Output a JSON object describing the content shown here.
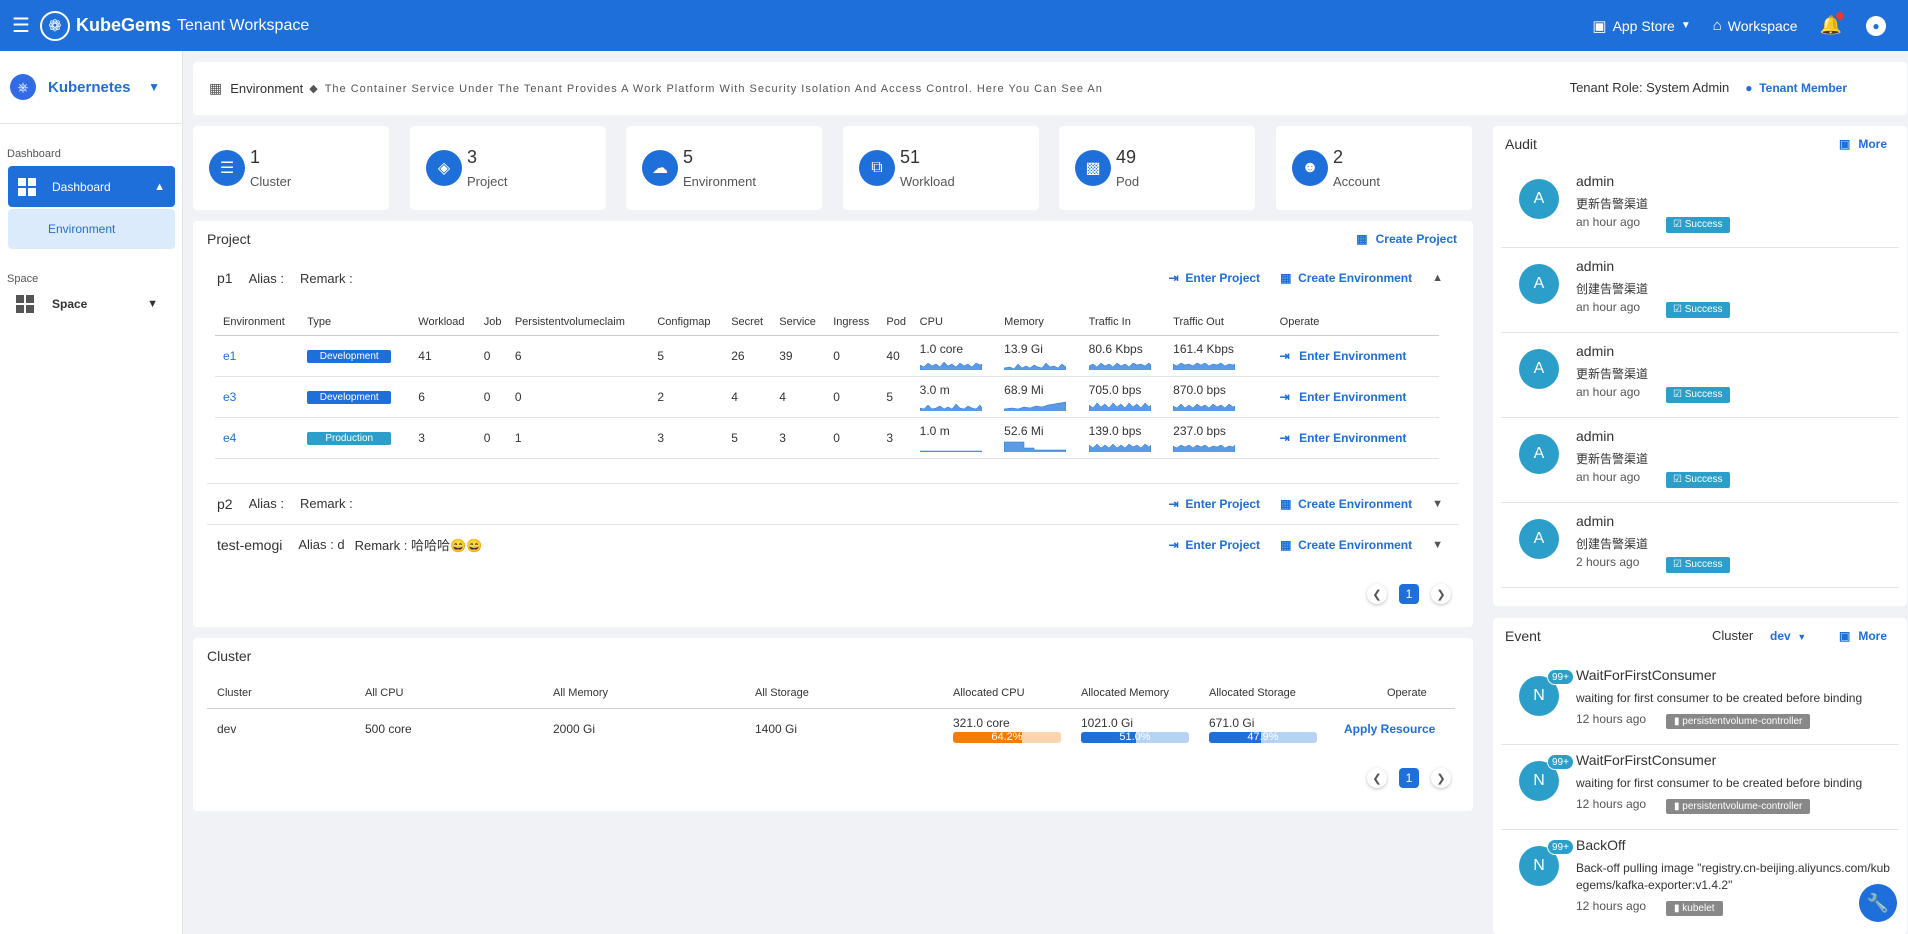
{
  "header": {
    "brand": "KubeGems",
    "subtitle": "Tenant Workspace",
    "app_store": "App Store",
    "workspace": "Workspace"
  },
  "sidebar": {
    "cluster_label": "Kubernetes",
    "section_dashboard": "Dashboard",
    "dashboard_label": "Dashboard",
    "environment_label": "Environment",
    "section_space": "Space",
    "space_label": "Space"
  },
  "envbar": {
    "title": "Environment",
    "description": "The Container Service Under The Tenant Provides A Work Platform With Security Isolation And Access Control. Here You Can See An",
    "role": "Tenant Role: System Admin",
    "member_button": "Tenant Member"
  },
  "stats": [
    {
      "value": "1",
      "label": "Cluster"
    },
    {
      "value": "3",
      "label": "Project"
    },
    {
      "value": "5",
      "label": "Environment"
    },
    {
      "value": "51",
      "label": "Workload"
    },
    {
      "value": "49",
      "label": "Pod"
    },
    {
      "value": "2",
      "label": "Account"
    }
  ],
  "project": {
    "title": "Project",
    "create_project": "Create Project",
    "enter_project": "Enter Project",
    "create_environment": "Create Environment",
    "projects": [
      {
        "name": "p1",
        "alias": "Alias :",
        "remark": "Remark :"
      },
      {
        "name": "p2",
        "alias": "Alias :",
        "remark": "Remark :"
      },
      {
        "name": "test-emogi",
        "alias": "Alias : d",
        "remark": "Remark : 哈哈哈😄😄"
      }
    ],
    "columns": [
      "Environment",
      "Type",
      "Workload",
      "Job",
      "Persistentvolumeclaim",
      "Configmap",
      "Secret",
      "Service",
      "Ingress",
      "Pod",
      "CPU",
      "Memory",
      "Traffic In",
      "Traffic Out",
      "Operate"
    ],
    "enter_environment": "Enter Environment",
    "rows": [
      {
        "env": "e1",
        "type": "Development",
        "workload": "41",
        "job": "0",
        "pvc": "6",
        "configmap": "5",
        "secret": "26",
        "service": "39",
        "ingress": "0",
        "pod": "40",
        "cpu": "1.0 core",
        "memory": "13.9 Gi",
        "traffic_in": "80.6 Kbps",
        "traffic_out": "161.4 Kbps"
      },
      {
        "env": "e3",
        "type": "Development",
        "workload": "6",
        "job": "0",
        "pvc": "0",
        "configmap": "2",
        "secret": "4",
        "service": "4",
        "ingress": "0",
        "pod": "5",
        "cpu": "3.0 m",
        "memory": "68.9 Mi",
        "traffic_in": "705.0 bps",
        "traffic_out": "870.0 bps"
      },
      {
        "env": "e4",
        "type": "Production",
        "workload": "3",
        "job": "0",
        "pvc": "1",
        "configmap": "3",
        "secret": "5",
        "service": "3",
        "ingress": "0",
        "pod": "3",
        "cpu": "1.0 m",
        "memory": "52.6 Mi",
        "traffic_in": "139.0 bps",
        "traffic_out": "237.0 bps"
      }
    ],
    "page": "1"
  },
  "cluster": {
    "title": "Cluster",
    "columns": [
      "Cluster",
      "All CPU",
      "All Memory",
      "All Storage",
      "Allocated CPU",
      "Allocated Memory",
      "Allocated Storage",
      "Operate"
    ],
    "row": {
      "name": "dev",
      "cpu": "500 core",
      "memory": "2000 Gi",
      "storage": "1400 Gi",
      "alloc_cpu": "321.0 core",
      "alloc_cpu_pct": "64.2%",
      "alloc_mem": "1021.0 Gi",
      "alloc_mem_pct": "51.0%",
      "alloc_storage": "671.0 Gi",
      "alloc_storage_pct": "47.9%",
      "operate": "Apply Resource"
    },
    "page": "1"
  },
  "audit": {
    "title": "Audit",
    "more": "More",
    "items": [
      {
        "avatar": "A",
        "user": "admin",
        "action": "更新告警渠道",
        "time": "an hour ago",
        "status": "Success"
      },
      {
        "avatar": "A",
        "user": "admin",
        "action": "创建告警渠道",
        "time": "an hour ago",
        "status": "Success"
      },
      {
        "avatar": "A",
        "user": "admin",
        "action": "更新告警渠道",
        "time": "an hour ago",
        "status": "Success"
      },
      {
        "avatar": "A",
        "user": "admin",
        "action": "更新告警渠道",
        "time": "an hour ago",
        "status": "Success"
      },
      {
        "avatar": "A",
        "user": "admin",
        "action": "创建告警渠道",
        "time": "2 hours ago",
        "status": "Success"
      }
    ]
  },
  "event": {
    "title": "Event",
    "cluster_label": "Cluster",
    "cluster_value": "dev",
    "more": "More",
    "items": [
      {
        "avatar": "N",
        "badge": "99+",
        "name": "WaitForFirstConsumer",
        "message": "waiting for first consumer to be created before binding",
        "time": "12 hours ago",
        "source": "persistentvolume-controller"
      },
      {
        "avatar": "N",
        "badge": "99+",
        "name": "WaitForFirstConsumer",
        "message": "waiting for first consumer to be created before binding",
        "time": "12 hours ago",
        "source": "persistentvolume-controller"
      },
      {
        "avatar": "N",
        "badge": "99+",
        "name": "BackOff",
        "message": "Back-off pulling image \"registry.cn-beijing.aliyuncs.com/kubegems/kafka-exporter:v1.4.2\"",
        "time": "12 hours ago",
        "source": "kubelet"
      }
    ]
  },
  "colors": {
    "primary": "#1e6fd9",
    "development": "#1e6fd9",
    "production": "#2b9fc9",
    "cpu_bar": "#f57c00",
    "mem_bar": "#1e6fd9",
    "storage_bar": "#1e6fd9",
    "success": "#2b9fc9"
  }
}
